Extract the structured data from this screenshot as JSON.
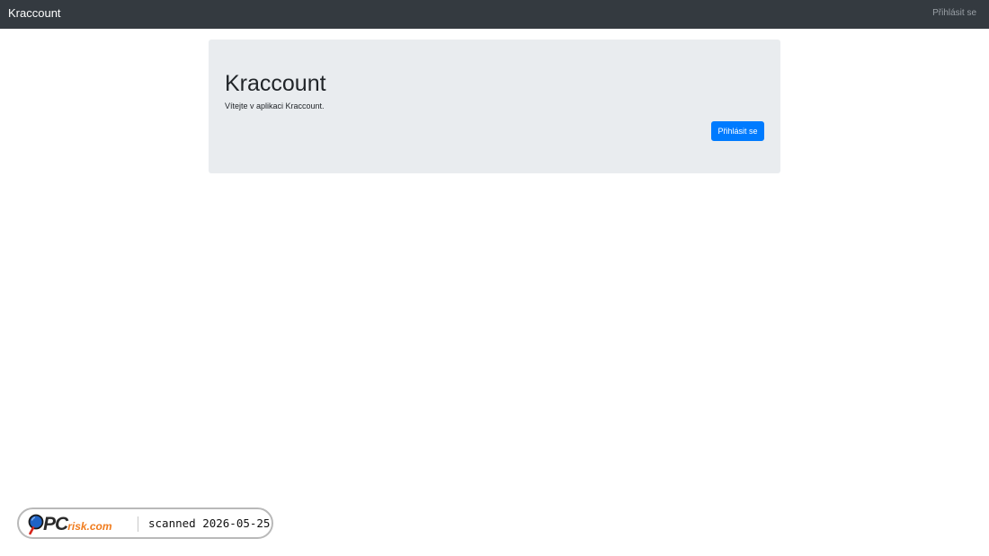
{
  "navbar": {
    "brand": "Kraccount",
    "login_link": "Přihlásit se",
    "background": "#343a40"
  },
  "jumbotron": {
    "title": "Kraccount",
    "lead": "Vítejte v aplikaci Kraccount.",
    "login_button": "Přihlásit se",
    "background": "#e9ecef",
    "button_color": "#007bff"
  },
  "watermark": {
    "brand_pc": "PC",
    "brand_risk": "risk.com",
    "scan_text": "scanned 2026-05-25",
    "logo_icon": "magnifier-icon"
  }
}
